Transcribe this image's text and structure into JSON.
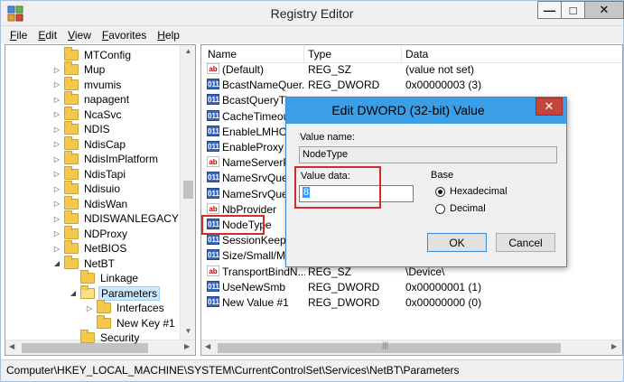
{
  "window": {
    "title": "Registry Editor",
    "min_glyph": "—",
    "max_glyph": "□",
    "close_glyph": "✕"
  },
  "menu": [
    {
      "first": "F",
      "rest": "ile"
    },
    {
      "first": "E",
      "rest": "dit"
    },
    {
      "first": "V",
      "rest": "iew"
    },
    {
      "first": "F",
      "rest": "avorites"
    },
    {
      "first": "H",
      "rest": "elp"
    }
  ],
  "tree": {
    "items": [
      {
        "label": "MTConfig",
        "expand": "",
        "selected": false
      },
      {
        "label": "Mup",
        "expand": "▷",
        "selected": false
      },
      {
        "label": "mvumis",
        "expand": "▷",
        "selected": false
      },
      {
        "label": "napagent",
        "expand": "▷",
        "selected": false
      },
      {
        "label": "NcaSvc",
        "expand": "▷",
        "selected": false
      },
      {
        "label": "NDIS",
        "expand": "▷",
        "selected": false
      },
      {
        "label": "NdisCap",
        "expand": "▷",
        "selected": false
      },
      {
        "label": "NdisImPlatform",
        "expand": "▷",
        "selected": false
      },
      {
        "label": "NdisTapi",
        "expand": "▷",
        "selected": false
      },
      {
        "label": "Ndisuio",
        "expand": "▷",
        "selected": false
      },
      {
        "label": "NdisWan",
        "expand": "▷",
        "selected": false
      },
      {
        "label": "NDISWANLEGACY",
        "expand": "▷",
        "selected": false
      },
      {
        "label": "NDProxy",
        "expand": "▷",
        "selected": false
      },
      {
        "label": "NetBIOS",
        "expand": "▷",
        "selected": false
      },
      {
        "label": "NetBT",
        "expand": "◢",
        "selected": false
      },
      {
        "label": "Linkage",
        "expand": "",
        "selected": false
      },
      {
        "label": "Parameters",
        "expand": "◢",
        "selected": true
      },
      {
        "label": "Interfaces",
        "expand": "▷",
        "selected": false
      },
      {
        "label": "New Key #1",
        "expand": "",
        "selected": false
      },
      {
        "label": "Security",
        "expand": "",
        "selected": false
      }
    ],
    "scroll_up": "▲",
    "scroll_down": "▼",
    "scroll_left": "◀",
    "scroll_right": "▶"
  },
  "list": {
    "columns": [
      "Name",
      "Type",
      "Data"
    ],
    "rows": [
      {
        "icon": "sz",
        "name": "(Default)",
        "type": "REG_SZ",
        "data": "(value not set)"
      },
      {
        "icon": "dw",
        "name": "BcastNameQuer...",
        "type": "REG_DWORD",
        "data": "0x00000003 (3)"
      },
      {
        "icon": "dw",
        "name": "BcastQueryTim",
        "type": "",
        "data": ""
      },
      {
        "icon": "dw",
        "name": "CacheTimeout",
        "type": "",
        "data": ""
      },
      {
        "icon": "dw",
        "name": "EnableLMHOST",
        "type": "",
        "data": ""
      },
      {
        "icon": "dw",
        "name": "EnableProxy",
        "type": "",
        "data": ""
      },
      {
        "icon": "sz",
        "name": "NameServerPo",
        "type": "",
        "data": ""
      },
      {
        "icon": "dw",
        "name": "NameSrvQuery",
        "type": "",
        "data": ""
      },
      {
        "icon": "dw",
        "name": "NameSrvQuery",
        "type": "",
        "data": ""
      },
      {
        "icon": "sz",
        "name": "NbProvider",
        "type": "",
        "data": ""
      },
      {
        "icon": "dw",
        "name": "NodeType",
        "type": "",
        "data": ""
      },
      {
        "icon": "dw",
        "name": "SessionKeepAli",
        "type": "",
        "data": ""
      },
      {
        "icon": "dw",
        "name": "Size/Small/Me",
        "type": "",
        "data": ""
      },
      {
        "icon": "sz",
        "name": "TransportBindN...",
        "type": "REG_SZ",
        "data": "\\Device\\"
      },
      {
        "icon": "dw",
        "name": "UseNewSmb",
        "type": "REG_DWORD",
        "data": "0x00000001 (1)"
      },
      {
        "icon": "dw",
        "name": "New Value #1",
        "type": "REG_DWORD",
        "data": "0x00000000 (0)"
      }
    ],
    "icon_sz_text": "ab",
    "icon_dw_text": "011",
    "scroll_grip": "|||"
  },
  "status": {
    "path": "Computer\\HKEY_LOCAL_MACHINE\\SYSTEM\\CurrentControlSet\\Services\\NetBT\\Parameters"
  },
  "dialog": {
    "title": "Edit DWORD (32-bit) Value",
    "close_glyph": "✕",
    "value_name_label": "Value name:",
    "value_name": "NodeType",
    "value_data_label": "Value data:",
    "value_data": "8",
    "base_label": "Base",
    "radio_hex": "Hexadecimal",
    "radio_dec": "Decimal",
    "ok_label": "OK",
    "cancel_label": "Cancel"
  }
}
